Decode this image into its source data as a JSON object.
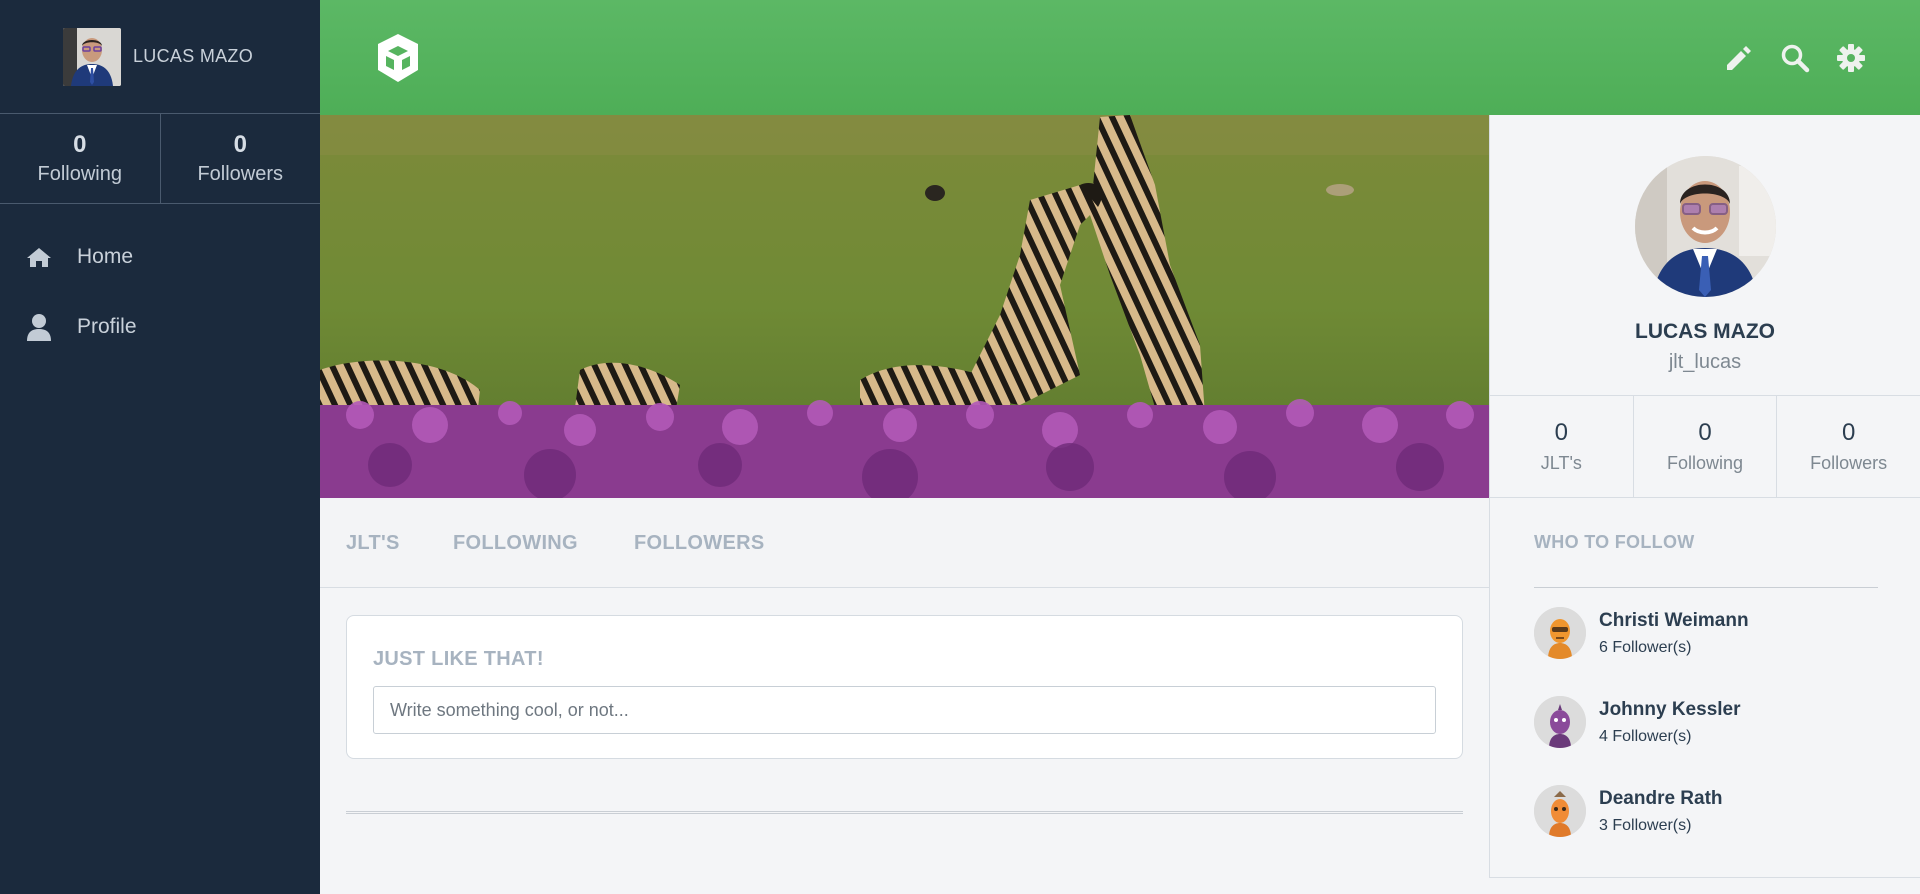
{
  "sidebar": {
    "user_name": "LUCAS MAZO",
    "stats": [
      {
        "value": "0",
        "label": "Following"
      },
      {
        "value": "0",
        "label": "Followers"
      }
    ],
    "nav": [
      {
        "label": "Home",
        "icon": "home-icon"
      },
      {
        "label": "Profile",
        "icon": "user-icon"
      }
    ]
  },
  "topbar": {
    "icons": [
      "edit-pencil-icon",
      "search-icon",
      "settings-gear-icon"
    ],
    "accent_color": "#56b45f"
  },
  "tabs": [
    "JLT'S",
    "FOLLOWING",
    "FOLLOWERS"
  ],
  "composer": {
    "title": "JUST LIKE THAT!",
    "placeholder": "Write something cool, or not...",
    "value": ""
  },
  "profile": {
    "name": "LUCAS MAZO",
    "handle": "jlt_lucas",
    "stats": [
      {
        "value": "0",
        "label": "JLT's"
      },
      {
        "value": "0",
        "label": "Following"
      },
      {
        "value": "0",
        "label": "Followers"
      }
    ]
  },
  "who_to_follow": {
    "title": "WHO TO FOLLOW",
    "users": [
      {
        "name": "Christi Weimann",
        "followers": "6 Follower(s)"
      },
      {
        "name": "Johnny Kessler",
        "followers": "4 Follower(s)"
      },
      {
        "name": "Deandre Rath",
        "followers": "3 Follower(s)"
      }
    ]
  },
  "colors": {
    "sidebar_bg": "#1b2a3d",
    "header_green": "#56b45f",
    "muted_text": "#a7b3c0"
  }
}
